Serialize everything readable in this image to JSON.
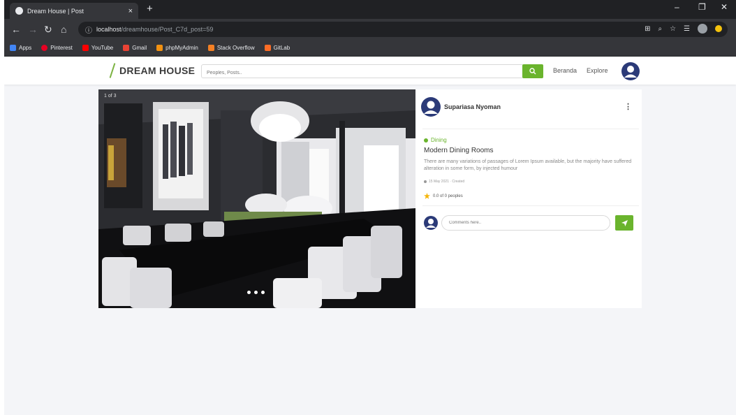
{
  "browser": {
    "tab_title": "Dream House | Post",
    "tab_close": "×",
    "new_tab": "+",
    "url_host": "localhost",
    "url_path": "/dreamhouse/Post_C7d_post=59",
    "minimize": "–",
    "restore": "❐",
    "close": "✕",
    "bookmarks": [
      {
        "label": "Apps",
        "color": "#4285f4"
      },
      {
        "label": "Pinterest",
        "color": "#e60023"
      },
      {
        "label": "YouTube",
        "color": "#ff0000"
      },
      {
        "label": "Gmail",
        "color": "#ea4335"
      },
      {
        "label": "phpMyAdmin",
        "color": "#f29111"
      },
      {
        "label": "Stack Overflow",
        "color": "#f48024"
      },
      {
        "label": "GitLab",
        "color": "#fc6d26"
      }
    ]
  },
  "site": {
    "logo": "DREAM HOUSE",
    "search_placeholder": "Peoples, Posts..",
    "nav_home": "Beranda",
    "nav_explore": "Explore"
  },
  "post": {
    "counter": "1 of 3",
    "author": "Supariasa Nyoman",
    "menu": "⋮",
    "category": "Dining",
    "title": "Modern Dining Rooms",
    "description": "There are many variations of passages of Lorem Ipsum available, but the majority have suffered alteration in some form, by injected humour",
    "meta": "15 May 2021 · Created",
    "rating": "0.0 of 0 peoples",
    "comment_placeholder": "Comments here.."
  },
  "colors": {
    "accent": "#6ab42d",
    "avatar": "#2b3a78",
    "star": "#f5b50a"
  }
}
